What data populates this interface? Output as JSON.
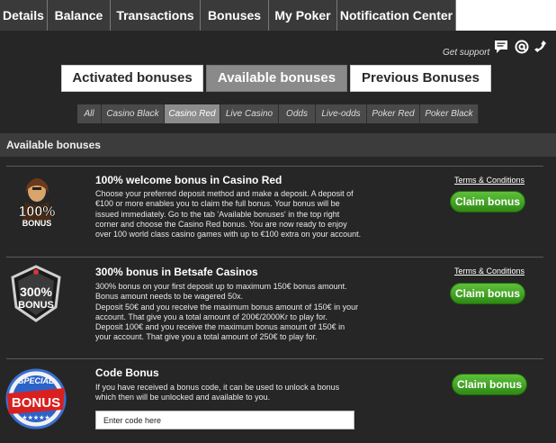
{
  "top_tabs": [
    "Details",
    "Balance",
    "Transactions",
    "Bonuses",
    "My Poker",
    "Notification Center"
  ],
  "support": {
    "label": "Get support",
    "icons": [
      "chat-icon",
      "email-icon",
      "phone-icon"
    ]
  },
  "bonus_tabs": [
    "Activated bonuses",
    "Available bonuses",
    "Previous Bonuses"
  ],
  "active_bonus_tab": "Available bonuses",
  "filters": [
    "All",
    "Casino Black",
    "Casino Red",
    "Live Casino",
    "Odds",
    "Live-odds",
    "Poker Red",
    "Poker Black"
  ],
  "active_filter": "Casino Red",
  "section_title": "Available bonuses",
  "offers": [
    {
      "title": "100% welcome bonus in Casino Red",
      "body": "Choose your preferred deposit method and make a deposit. A deposit of €100 or more enables you to claim the full bonus. Your bonus will be issued immediately. Go to the tab 'Available bonuses' in the top right corner and choose the Casino Red bonus. You are now ready to enjoy over 100 world class casino games with up to €100 extra on your account.",
      "terms": "Terms & Conditions",
      "cta": "Claim bonus",
      "badge": "100%",
      "badge_sub": "BONUS"
    },
    {
      "title": "300% bonus in Betsafe Casinos",
      "body": "300% bonus on your first deposit up to maximum 150€ bonus amount. Bonus amount needs to be wagered 50x.\nDeposit 50€ and you receive the maximum bonus amount of 150€ in your account. That give you a total amount of 200€/2000Kr to play for.\nDeposit 100€ and you receive the maximum bonus amount of 150€ in your account. That give you a total amount of 250€ to play for.",
      "terms": "Terms & Conditions",
      "cta": "Claim bonus",
      "badge": "300%",
      "badge_sub": "BONUS"
    },
    {
      "title": "Code Bonus",
      "body": "If you have received a bonus code, it can be used to unlock a bonus which then will be unlocked and available to you.",
      "cta": "Claim bonus",
      "badge": "SPECIAL",
      "badge_sub": "BONUS",
      "input_placeholder": "Enter code here"
    }
  ],
  "colors": {
    "panel": "#262626",
    "claim_green": "#3aa01e",
    "active_tab": "#8a8a8a"
  }
}
